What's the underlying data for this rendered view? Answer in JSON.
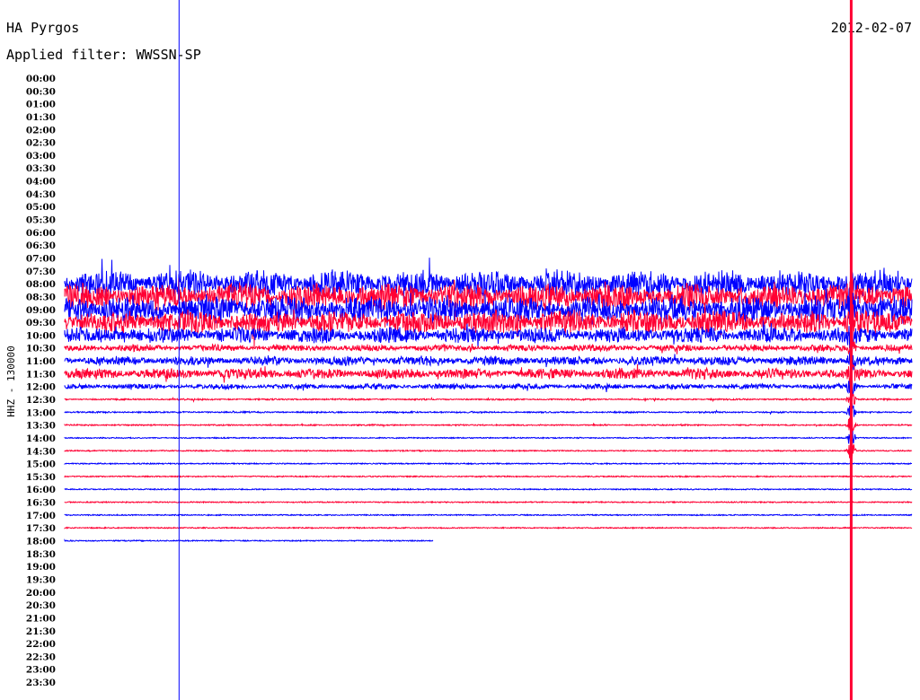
{
  "chart_data": {
    "type": "line",
    "title": "HA Pyrgos",
    "date": "2012-02-07",
    "subtitle": "Applied filter: WWSSN-SP",
    "ylabel": "HHZ - 130000",
    "xlabel": "",
    "row_interval_minutes": 30,
    "tick_labels": [
      "00:00",
      "00:30",
      "01:00",
      "01:30",
      "02:00",
      "02:30",
      "03:00",
      "03:30",
      "04:00",
      "04:30",
      "05:00",
      "05:30",
      "06:00",
      "06:30",
      "07:00",
      "07:30",
      "08:00",
      "08:30",
      "09:00",
      "09:30",
      "10:00",
      "10:30",
      "11:00",
      "11:30",
      "12:00",
      "12:30",
      "13:00",
      "13:30",
      "14:00",
      "14:30",
      "15:00",
      "15:30",
      "16:00",
      "16:30",
      "17:00",
      "17:30",
      "18:00",
      "18:30",
      "19:00",
      "19:30",
      "20:00",
      "20:30",
      "21:00",
      "21:30",
      "22:00",
      "22:30",
      "23:00",
      "23:30"
    ],
    "colors": {
      "even_row": "#0000ff",
      "odd_row": "#ff0033",
      "marker_blue": "#0000ff",
      "marker_red": "#ff0033"
    },
    "series": [
      {
        "name": "08:00",
        "relative_amplitude": 1.0,
        "coverage": 1.0
      },
      {
        "name": "08:30",
        "relative_amplitude": 1.0,
        "coverage": 1.0
      },
      {
        "name": "09:00",
        "relative_amplitude": 1.0,
        "coverage": 1.0
      },
      {
        "name": "09:30",
        "relative_amplitude": 0.9,
        "coverage": 1.0
      },
      {
        "name": "10:00",
        "relative_amplitude": 0.6,
        "coverage": 1.0
      },
      {
        "name": "10:30",
        "relative_amplitude": 0.25,
        "coverage": 1.0
      },
      {
        "name": "11:00",
        "relative_amplitude": 0.35,
        "coverage": 1.0
      },
      {
        "name": "11:30",
        "relative_amplitude": 0.4,
        "coverage": 1.0
      },
      {
        "name": "12:00",
        "relative_amplitude": 0.2,
        "coverage": 1.0
      },
      {
        "name": "12:30",
        "relative_amplitude": 0.06,
        "coverage": 1.0
      },
      {
        "name": "13:00",
        "relative_amplitude": 0.06,
        "coverage": 1.0
      },
      {
        "name": "13:30",
        "relative_amplitude": 0.05,
        "coverage": 1.0
      },
      {
        "name": "14:00",
        "relative_amplitude": 0.03,
        "coverage": 1.0
      },
      {
        "name": "14:30",
        "relative_amplitude": 0.03,
        "coverage": 1.0
      },
      {
        "name": "15:00",
        "relative_amplitude": 0.03,
        "coverage": 1.0
      },
      {
        "name": "15:30",
        "relative_amplitude": 0.03,
        "coverage": 1.0
      },
      {
        "name": "16:00",
        "relative_amplitude": 0.03,
        "coverage": 1.0
      },
      {
        "name": "16:30",
        "relative_amplitude": 0.03,
        "coverage": 1.0
      },
      {
        "name": "17:00",
        "relative_amplitude": 0.02,
        "coverage": 1.0
      },
      {
        "name": "17:30",
        "relative_amplitude": 0.03,
        "coverage": 1.0
      },
      {
        "name": "18:00",
        "relative_amplitude": 0.03,
        "coverage": 0.435
      }
    ],
    "markers": [
      {
        "type": "vertical",
        "color": "blue",
        "minute": 8.1
      },
      {
        "type": "vertical",
        "color": "red",
        "minute": 55.7
      }
    ]
  }
}
